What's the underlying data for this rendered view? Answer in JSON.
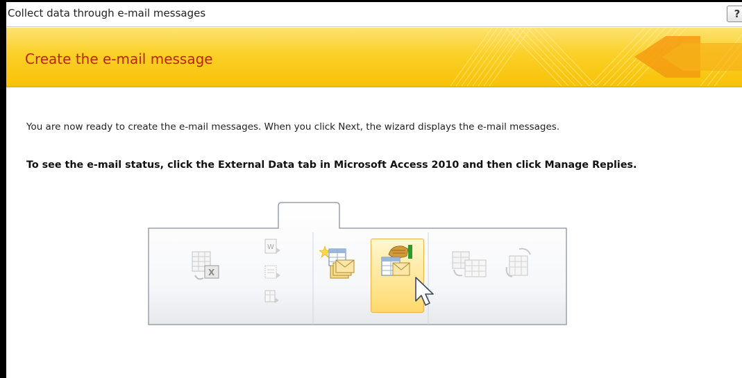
{
  "window": {
    "title": "Collect data through e-mail messages",
    "help_label": "?"
  },
  "banner": {
    "title": "Create the e-mail message"
  },
  "content": {
    "instruction": "You are now ready to create the e-mail messages. When you click Next, the wizard displays the e-mail messages.",
    "status_note": "To see the e-mail status, click the External Data tab in Microsoft Access 2010 and then click Manage Replies."
  },
  "ribbon_illustration": {
    "icons": [
      "import-excel-icon",
      "import-word-icon",
      "import-text-icon",
      "import-more-icon",
      "create-email-icon",
      "manage-replies-icon",
      "export-table-icon",
      "export-list-icon"
    ],
    "active_icon": "manage-replies-icon"
  },
  "colors": {
    "banner_yellow": "#fbd028",
    "banner_title": "#b8250c",
    "highlight": "#ffe79a"
  }
}
